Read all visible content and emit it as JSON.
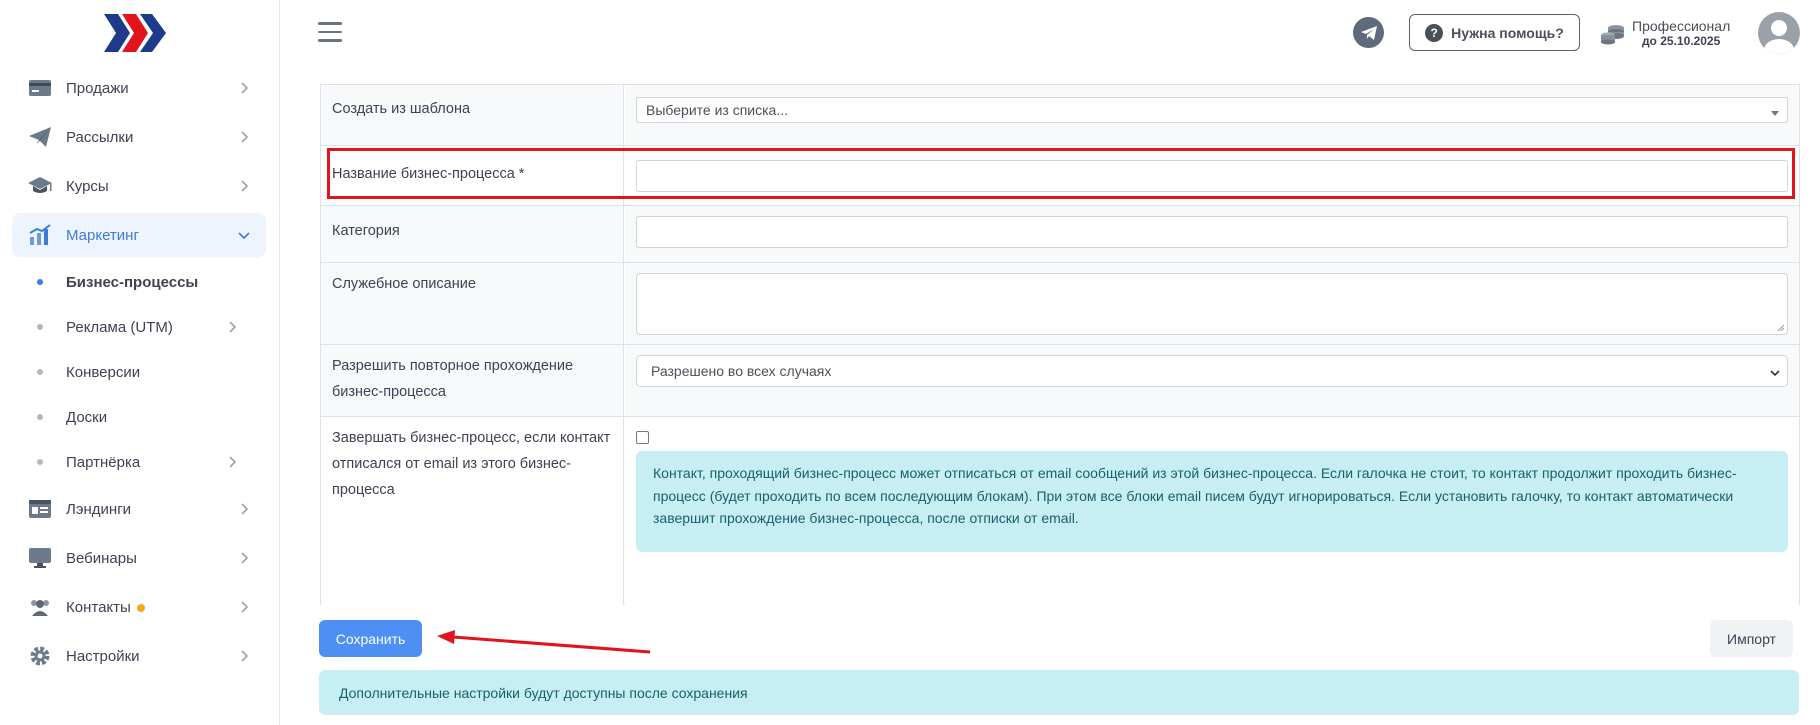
{
  "sidebar": {
    "items": [
      {
        "label": "Продажи",
        "icon": "wallet-icon"
      },
      {
        "label": "Рассылки",
        "icon": "paper-plane-icon"
      },
      {
        "label": "Курсы",
        "icon": "graduation-cap-icon"
      },
      {
        "label": "Маркетинг",
        "icon": "bar-chart-icon"
      },
      {
        "label": "Лэндинги",
        "icon": "landing-page-icon"
      },
      {
        "label": "Вебинары",
        "icon": "monitor-icon"
      },
      {
        "label": "Контакты",
        "icon": "users-icon"
      },
      {
        "label": "Настройки",
        "icon": "gear-icon"
      }
    ],
    "marketing_sub": [
      {
        "label": "Бизнес-процессы"
      },
      {
        "label": "Реклама (UTM)"
      },
      {
        "label": "Конверсии"
      },
      {
        "label": "Доски"
      },
      {
        "label": "Партнёрка"
      }
    ]
  },
  "header": {
    "help_label": "Нужна помощь?",
    "plan_name": "Профессионал",
    "plan_until": "до 25.10.2025"
  },
  "form": {
    "template_label": "Создать из шаблона",
    "template_placeholder": "Выберите из списка...",
    "name_label": "Название бизнес-процесса *",
    "name_value": "",
    "category_label": "Категория",
    "category_value": "",
    "description_label": "Служебное описание",
    "repeat_label": "Разрешить повторное прохождение бизнес-процесса",
    "repeat_value": "Разрешено во всех случаях",
    "unsubscribe_label": "Завершать бизнес-процесс, если контакт отписался от email из этого бизнес-процесса",
    "unsubscribe_checked": false,
    "unsubscribe_info": "Контакт, проходящий бизнес-процесс может отписаться от email сообщений из этой бизнес-процесса. Если галочка не стоит, то контакт продолжит проходить бизнес-процесс (будет проходить по всем последующим блокам). При этом все блоки email писем будут игнорироваться. Если установить галочку, то контакт автоматически завершит прохождение бизнес-процесса, после отписки от email."
  },
  "actions": {
    "save_label": "Сохранить",
    "import_label": "Импорт"
  },
  "bottom_info": "Дополнительные настройки будут доступны после сохранения",
  "colors": {
    "accent": "#3b7ddd",
    "save_button": "#4e8ff4",
    "highlight": "#e1141e",
    "info_bg": "#c7eff3"
  }
}
